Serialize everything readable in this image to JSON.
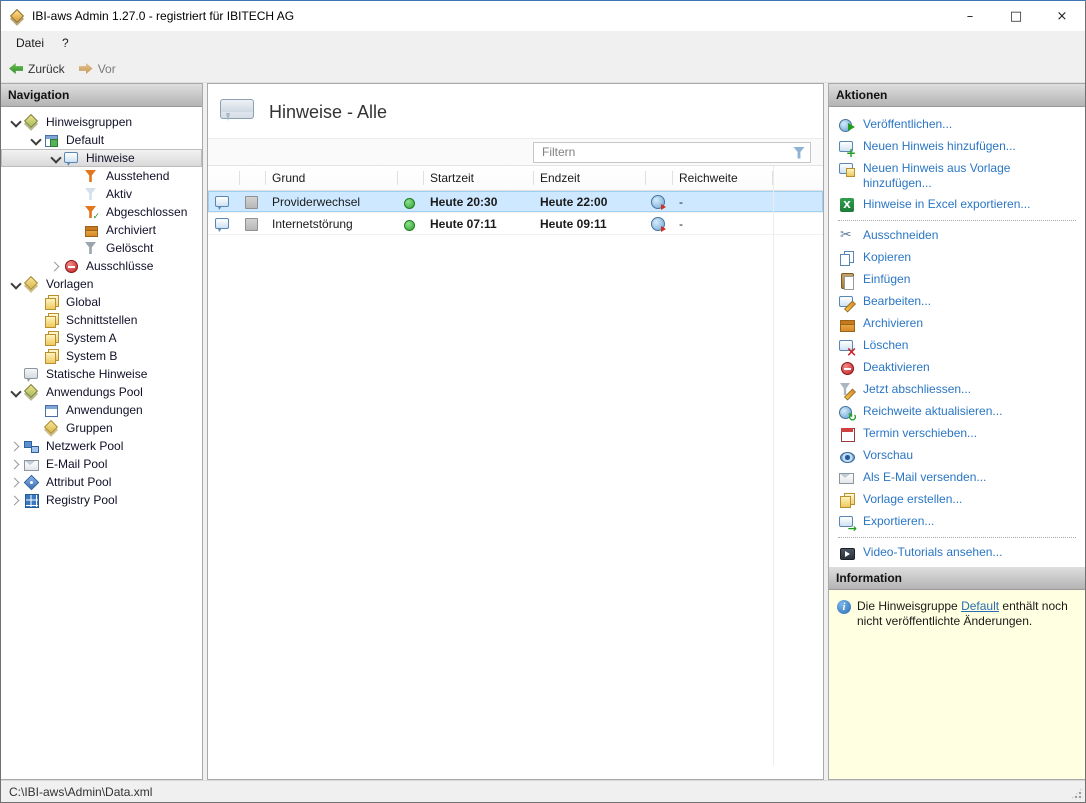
{
  "window": {
    "title": "IBI-aws Admin 1.27.0 - registriert für IBITECH AG",
    "controls": {
      "minimize": "–",
      "maximize": "□",
      "close": "×"
    }
  },
  "menu": {
    "items": [
      {
        "label": "Datei"
      },
      {
        "label": "?"
      }
    ]
  },
  "toolbar": {
    "back": "Zurück",
    "forward": "Vor"
  },
  "navigation": {
    "header": "Navigation",
    "tree": [
      {
        "label": "Hinweisgruppen",
        "icon": "layers-group-icon",
        "state": "expanded"
      },
      {
        "label": "Default",
        "icon": "group-window-icon",
        "state": "expanded"
      },
      {
        "label": "Hinweise",
        "icon": "hint-bubble-icon",
        "state": "expanded",
        "selected": true
      },
      {
        "label": "Ausstehend",
        "icon": "filter-pending-icon"
      },
      {
        "label": "Aktiv",
        "icon": "filter-active-icon"
      },
      {
        "label": "Abgeschlossen",
        "icon": "filter-completed-icon"
      },
      {
        "label": "Archiviert",
        "icon": "archive-box-icon"
      },
      {
        "label": "Gelöscht",
        "icon": "filter-deleted-icon"
      },
      {
        "label": "Ausschlüsse",
        "icon": "exclusions-noentry-icon",
        "state": "collapsed"
      },
      {
        "label": "Vorlagen",
        "icon": "templates-layers-icon",
        "state": "expanded"
      },
      {
        "label": "Global",
        "icon": "template-file-icon"
      },
      {
        "label": "Schnittstellen",
        "icon": "template-file-icon"
      },
      {
        "label": "System A",
        "icon": "template-file-icon"
      },
      {
        "label": "System B",
        "icon": "template-file-icon"
      },
      {
        "label": "Statische Hinweise",
        "icon": "static-hint-bubble-icon"
      },
      {
        "label": "Anwendungs Pool",
        "icon": "app-pool-layers-icon",
        "state": "expanded"
      },
      {
        "label": "Anwendungen",
        "icon": "application-window-icon"
      },
      {
        "label": "Gruppen",
        "icon": "groups-layers-icon"
      },
      {
        "label": "Netzwerk Pool",
        "icon": "network-icon",
        "state": "collapsed"
      },
      {
        "label": "E-Mail Pool",
        "icon": "envelope-icon",
        "state": "collapsed"
      },
      {
        "label": "Attribut Pool",
        "icon": "attribute-tag-icon",
        "state": "collapsed"
      },
      {
        "label": "Registry Pool",
        "icon": "registry-grid-icon",
        "state": "collapsed"
      }
    ]
  },
  "main": {
    "title": "Hinweise - Alle",
    "filter_placeholder": "Filtern",
    "table": {
      "headers": {
        "grund": "Grund",
        "startzeit": "Startzeit",
        "endzeit": "Endzeit",
        "reichweite": "Reichweite"
      },
      "rows": [
        {
          "grund": "Providerwechsel",
          "status_icon": "green-dot",
          "startzeit": "Heute 20:30",
          "endzeit": "Heute 22:00",
          "scope_icon": "globe",
          "reichweite": "-",
          "selected": true
        },
        {
          "grund": "Internetstörung",
          "status_icon": "green-dot",
          "startzeit": "Heute 07:11",
          "endzeit": "Heute 09:11",
          "scope_icon": "globe",
          "reichweite": "-",
          "selected": false
        }
      ]
    }
  },
  "actions": {
    "header": "Aktionen",
    "items": [
      {
        "label": "Veröffentlichen...",
        "icon": "publish-globe-icon"
      },
      {
        "label": "Neuen Hinweis hinzufügen...",
        "icon": "bubble-plus-icon"
      },
      {
        "label": "Neuen Hinweis aus Vorlage hinzufügen...",
        "icon": "bubble-template-icon"
      },
      {
        "label": "Hinweise in Excel exportieren...",
        "icon": "excel-icon"
      },
      {
        "label": "Ausschneiden",
        "icon": "scissors-icon"
      },
      {
        "label": "Kopieren",
        "icon": "copy-icon"
      },
      {
        "label": "Einfügen",
        "icon": "paste-icon"
      },
      {
        "label": "Bearbeiten...",
        "icon": "edit-pencil-icon"
      },
      {
        "label": "Archivieren",
        "icon": "archive-box-icon"
      },
      {
        "label": "Löschen",
        "icon": "delete-x-icon"
      },
      {
        "label": "Deaktivieren",
        "icon": "deactivate-icon"
      },
      {
        "label": "Jetzt abschliessen...",
        "icon": "finish-now-icon"
      },
      {
        "label": "Reichweite aktualisieren...",
        "icon": "refresh-globe-icon"
      },
      {
        "label": "Termin verschieben...",
        "icon": "calendar-icon"
      },
      {
        "label": "Vorschau",
        "icon": "preview-eye-icon"
      },
      {
        "label": "Als E-Mail versenden...",
        "icon": "send-email-icon"
      },
      {
        "label": "Vorlage erstellen...",
        "icon": "create-template-icon"
      },
      {
        "label": "Exportieren...",
        "icon": "export-arrow-icon"
      },
      {
        "label": "Video-Tutorials ansehen...",
        "icon": "video-icon"
      }
    ]
  },
  "information": {
    "header": "Information",
    "text_before": "Die Hinweisgruppe ",
    "link": "Default",
    "text_after": " enthält noch nicht veröffentlichte Änderungen."
  },
  "statusbar": {
    "path": "C:\\IBI-aws\\Admin\\Data.xml"
  },
  "colors": {
    "link_blue": "#2a76c4",
    "selection_blue": "#cde8ff",
    "info_yellow": "#ffffe1",
    "status_green": "#2fa52f",
    "panel_header_gray": "#c8c8c8"
  }
}
